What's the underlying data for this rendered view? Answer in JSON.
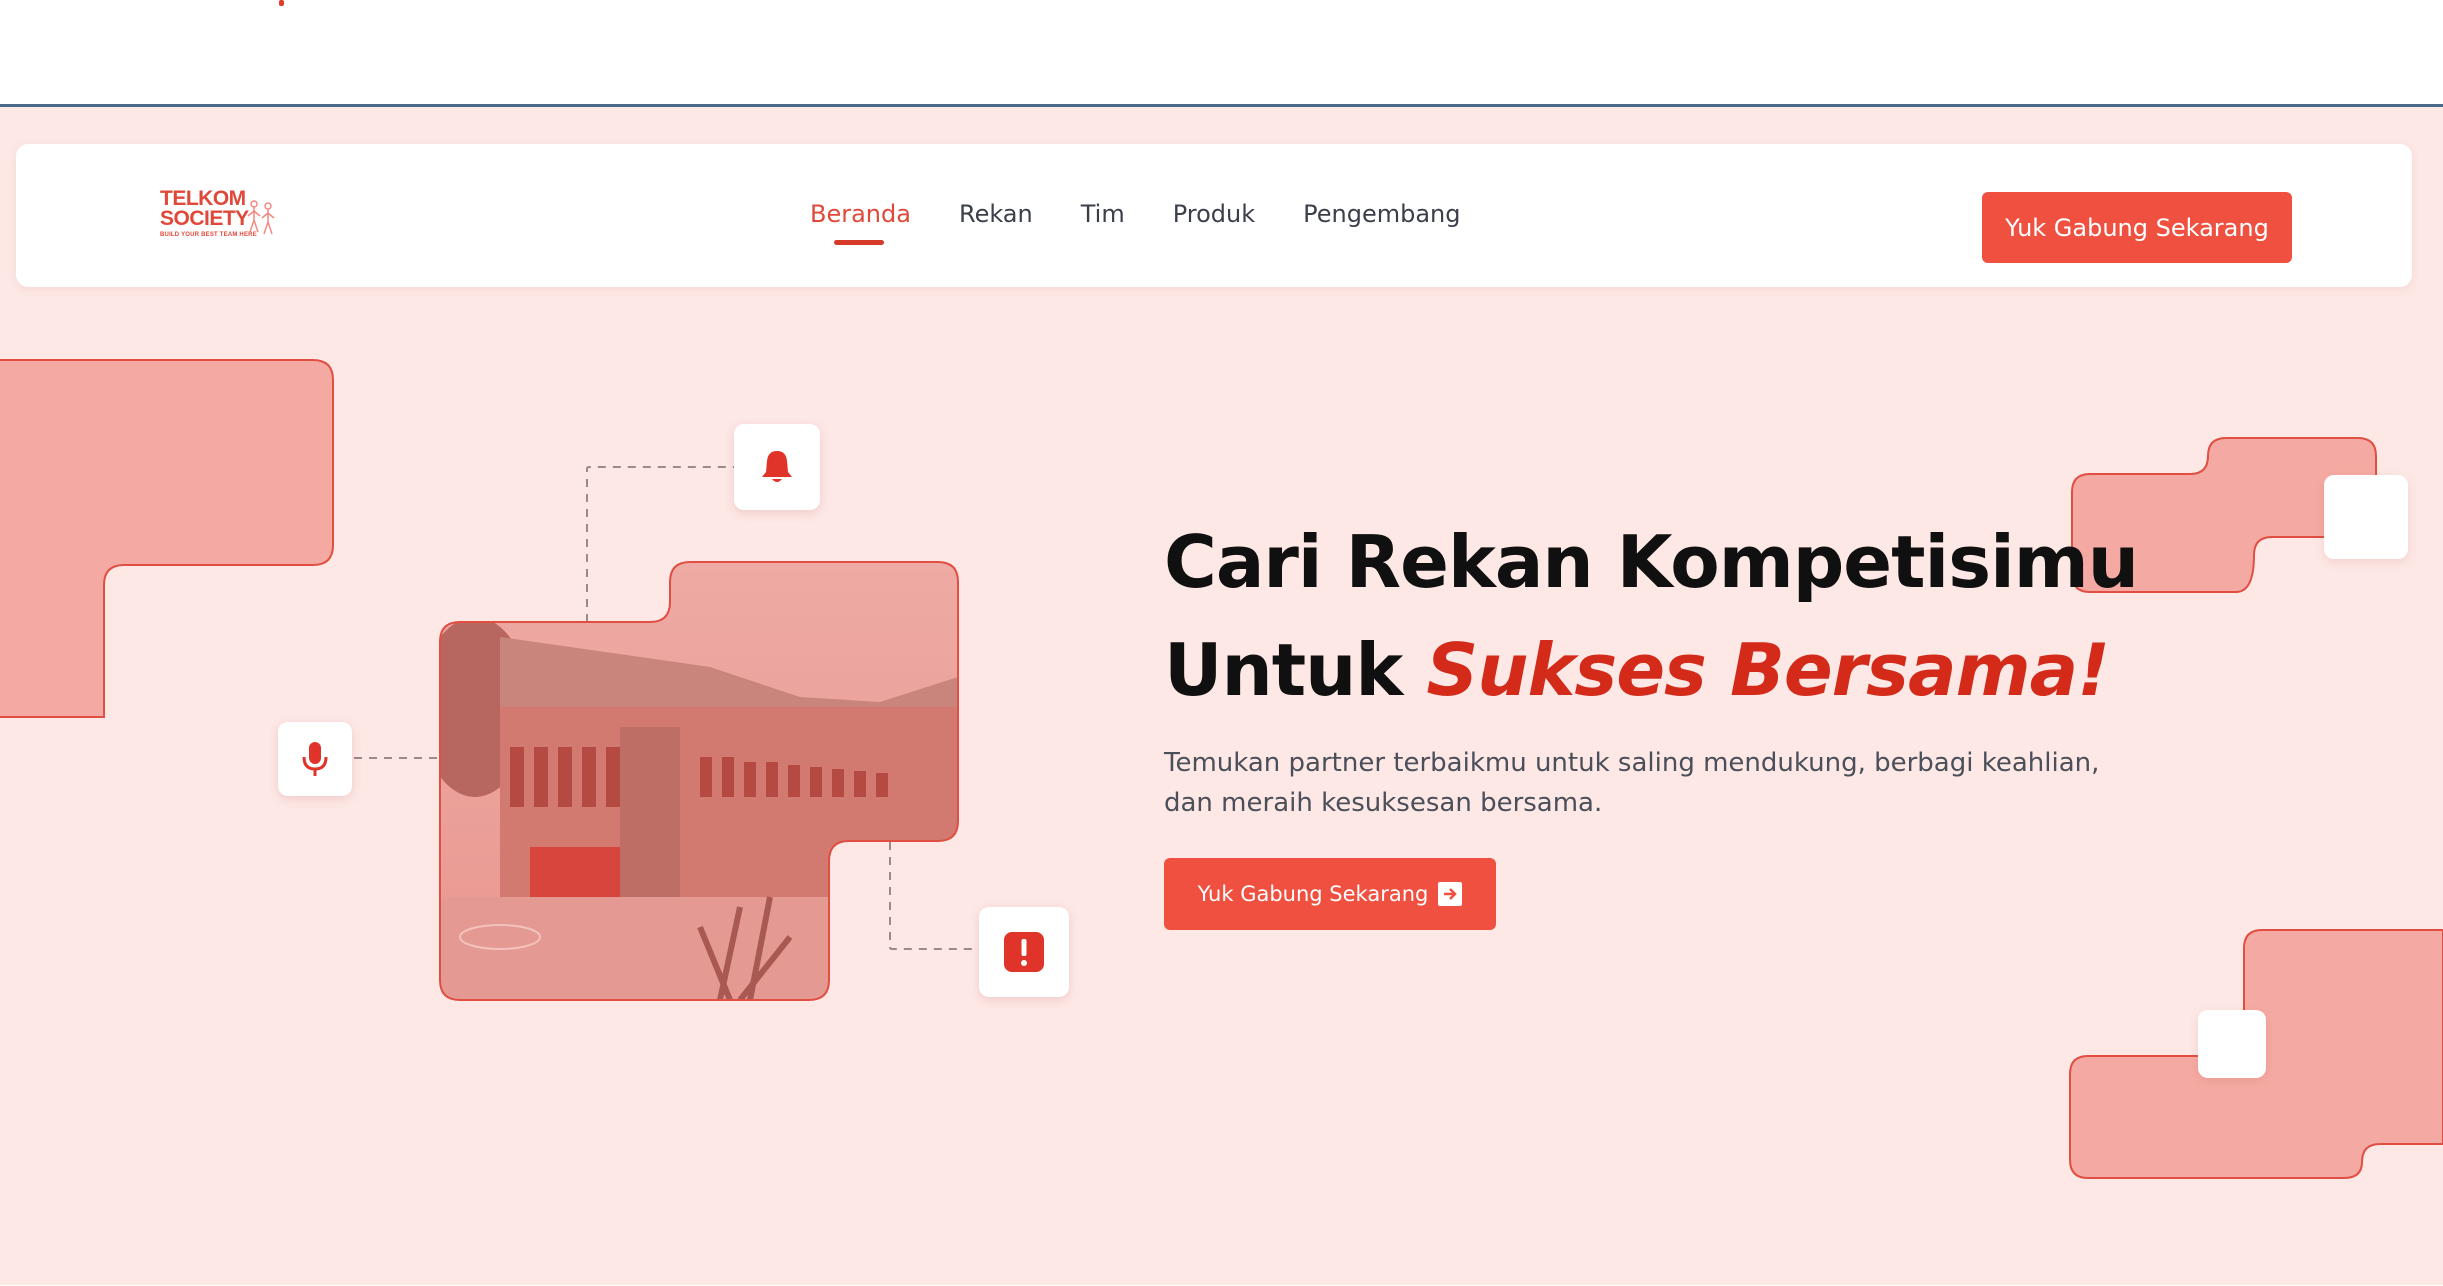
{
  "logo": {
    "line1": "TELKOM",
    "line2": "SOCIETY",
    "tagline": "BUILD YOUR BEST TEAM HERE"
  },
  "nav": {
    "items": [
      {
        "label": "Beranda",
        "active": true
      },
      {
        "label": "Rekan"
      },
      {
        "label": "Tim"
      },
      {
        "label": "Produk"
      },
      {
        "label": "Pengembang"
      }
    ],
    "cta": "Yuk Gabung Sekarang"
  },
  "hero": {
    "headline_line1": "Cari Rekan Kompetisimu",
    "headline_line2_plain": "Untuk ",
    "headline_line2_accent": "Sukses Bersama!",
    "description": "Temukan partner terbaikmu untuk saling mendukung, berbagi keahlian, dan meraih kesuksesan bersama.",
    "cta": "Yuk Gabung Sekarang"
  },
  "icons": {
    "bell": "bell-icon",
    "mic": "microphone-icon",
    "alert": "alert-icon",
    "arrow": "arrow-right-icon"
  },
  "colors": {
    "accent": "#ef5040",
    "accent_dark": "#d42a1a",
    "background": "#fde8e6",
    "shape_fill": "#f4aaa2"
  }
}
